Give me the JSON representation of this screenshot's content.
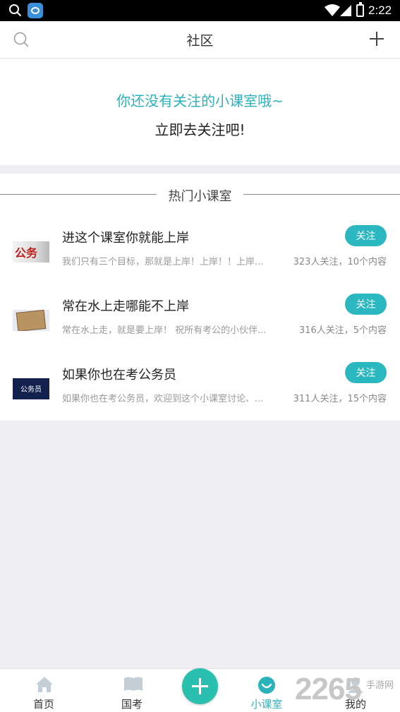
{
  "status_bar": {
    "time": "2:22"
  },
  "header": {
    "title": "社区"
  },
  "empty_state": {
    "line1": "你还没有关注的小课室哦~",
    "line2": "立即去关注吧!"
  },
  "hot_section": {
    "title": "热门小课室",
    "items": [
      {
        "name": "进这个课室你就能上岸",
        "desc": "我们只有三个目标，那就是上岸！上岸！！上岸...",
        "stats": "323人关注，10个内容",
        "follow_label": "关注",
        "thumb_text": "公务"
      },
      {
        "name": "常在水上走哪能不上岸",
        "desc": "常在水上走，就是要上岸！ 祝所有考公的小伙伴...",
        "stats": "316人关注，5个内容",
        "follow_label": "关注"
      },
      {
        "name": "如果你也在考公务员",
        "desc": "如果你也在考公务员，欢迎到这个小课室讨论、...",
        "stats": "311人关注，15个内容",
        "follow_label": "关注",
        "thumb_text": "公务员"
      }
    ]
  },
  "tabbar": {
    "tabs": [
      {
        "label": "首页"
      },
      {
        "label": "国考"
      },
      {
        "label": "小课室"
      },
      {
        "label": "我的"
      }
    ],
    "active_tab": "小课室"
  },
  "watermark": {
    "number": "2265",
    "text": "手游网"
  },
  "colors": {
    "accent": "#2ab3bd",
    "follow_button": "#2ab7bf",
    "center_button": "#2ac0b0"
  },
  "icons": [
    "search-icon",
    "app-icon",
    "wifi-icon",
    "signal-icon",
    "battery-icon",
    "plus-icon",
    "home-icon",
    "book-icon",
    "smile-icon",
    "person-icon"
  ]
}
